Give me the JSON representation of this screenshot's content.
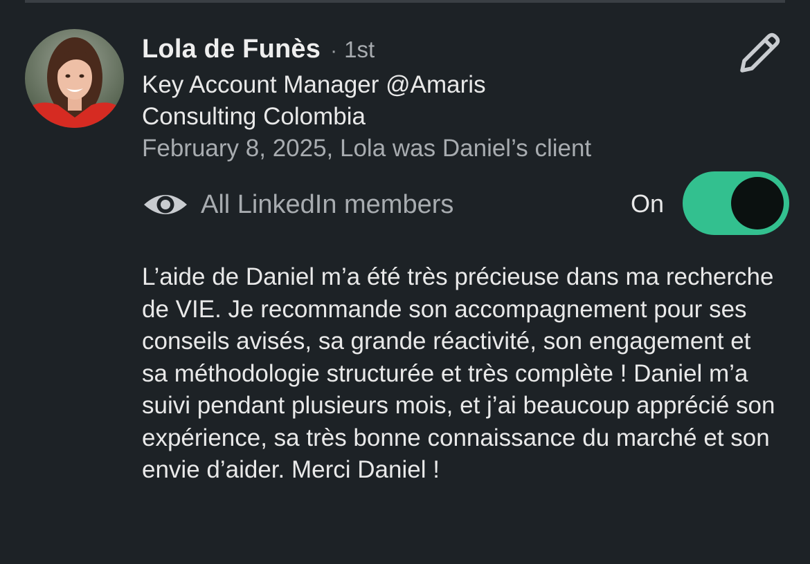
{
  "recommendation": {
    "author": {
      "name": "Lola de Funès",
      "separator": "·",
      "degree": "1st",
      "headline": "Key Account Manager @Amaris Consulting Colombia"
    },
    "relationship": "February 8, 2025, Lola was Daniel’s client",
    "visibility": {
      "icon": "eye-icon",
      "label": "All LinkedIn members",
      "toggle_state": "On",
      "toggle_on": true,
      "toggle_color": "#33c08f"
    },
    "text": "L’aide de Daniel m’a été très précieuse dans ma recherche de VIE. Je recommande son accompagnement pour ses conseils avisés, sa grande réactivité, son engagement et sa méthodologie structurée et très complète ! Daniel m’a suivi pendant plusieurs mois, et j’ai beaucoup apprécié son expérience, sa très bonne connaissance du marché et son envie d’aider. Merci Daniel !",
    "edit_icon": "pencil-icon"
  },
  "colors": {
    "background": "#1d2226",
    "primary_text": "#e9e9e9",
    "secondary_text": "#a8acb0"
  }
}
